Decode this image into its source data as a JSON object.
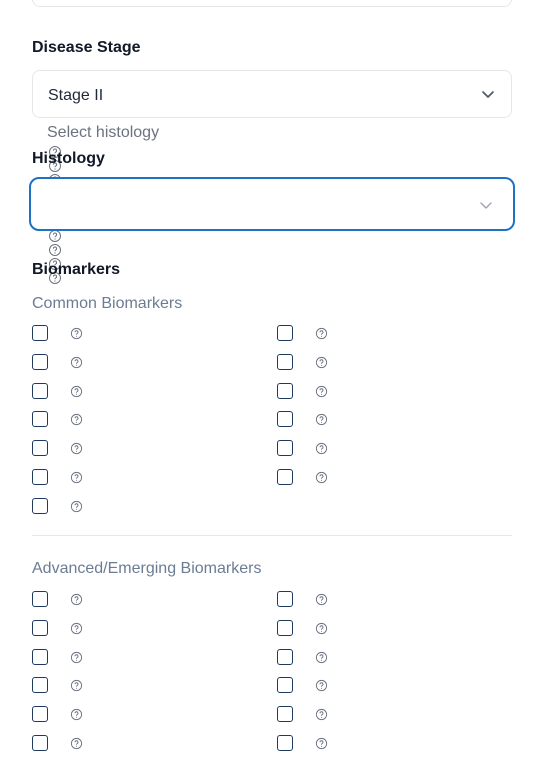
{
  "disease_stage": {
    "label": "Disease Stage",
    "value": "Stage II"
  },
  "histology": {
    "label": "Histology",
    "placeholder": "Select histology",
    "value": ""
  },
  "biomarkers": {
    "label": "Biomarkers",
    "common_title": "Common Biomarkers",
    "advanced_title": "Advanced/Emerging Biomarkers"
  },
  "colors": {
    "focus_ring": "#1d72c6",
    "checkbox_border": "#1e3a5f",
    "section_title": "#6b7c93"
  }
}
